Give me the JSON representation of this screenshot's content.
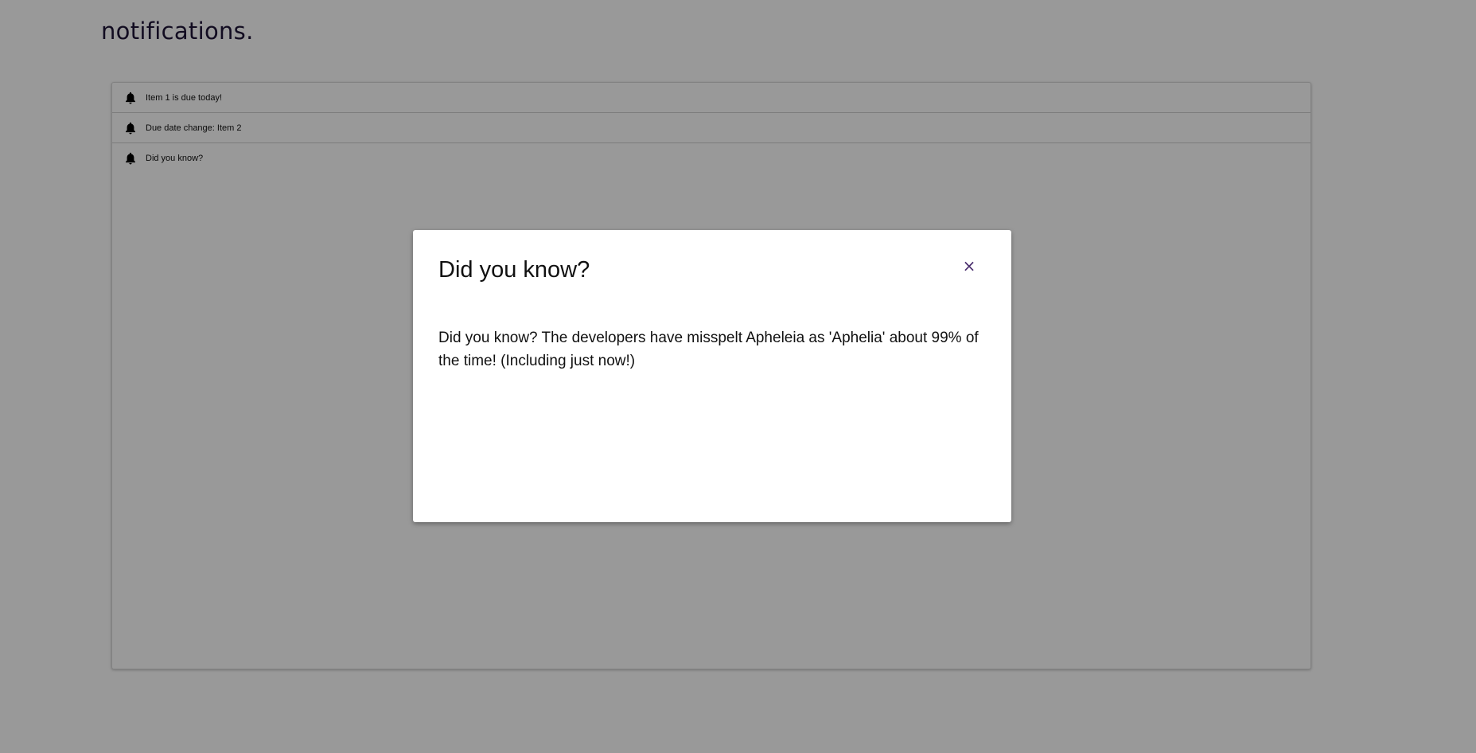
{
  "page": {
    "title": "notifications."
  },
  "notifications": [
    {
      "icon": "bell-icon",
      "label": "Item 1 is due today!"
    },
    {
      "icon": "bell-icon",
      "label": "Due date change: Item 2"
    },
    {
      "icon": "bell-icon",
      "label": "Did you know?"
    }
  ],
  "modal": {
    "title": "Did you know?",
    "close_label": "×",
    "body": "Did you know? The developers have misspelt Apheleia as 'Aphelia' about 99% of the time! (Including just now!)"
  },
  "colors": {
    "title_text": "#1e1537",
    "close_icon": "#4a2e6e",
    "overlay": "rgba(0,0,0,0.40)"
  }
}
